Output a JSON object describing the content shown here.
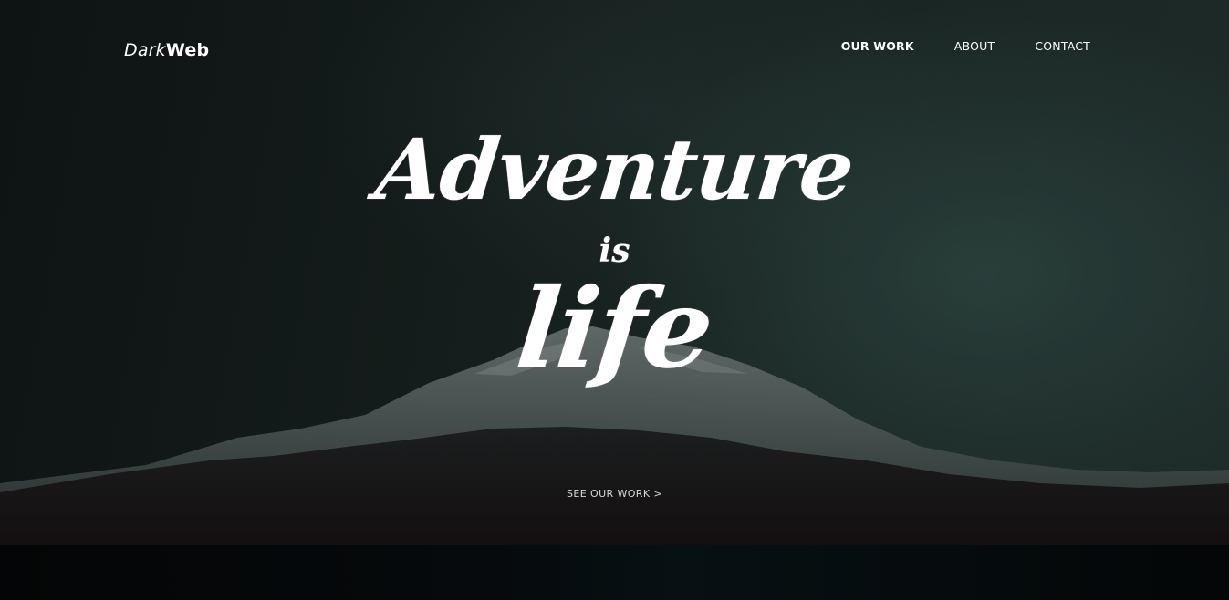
{
  "brand": {
    "logo_light": "Dark",
    "logo_bold": "Web"
  },
  "nav": {
    "items": [
      {
        "label": "OUR WORK",
        "active": true
      },
      {
        "label": "ABOUT",
        "active": false
      },
      {
        "label": "CONTACT",
        "active": false
      }
    ]
  },
  "hero": {
    "line1": "Adventure",
    "line2": "is",
    "line3": "life",
    "cta_label": "SEE OUR WORK >"
  },
  "colors": {
    "text": "#ffffff",
    "background": "#141c1b",
    "accent": "#1d2a28"
  }
}
